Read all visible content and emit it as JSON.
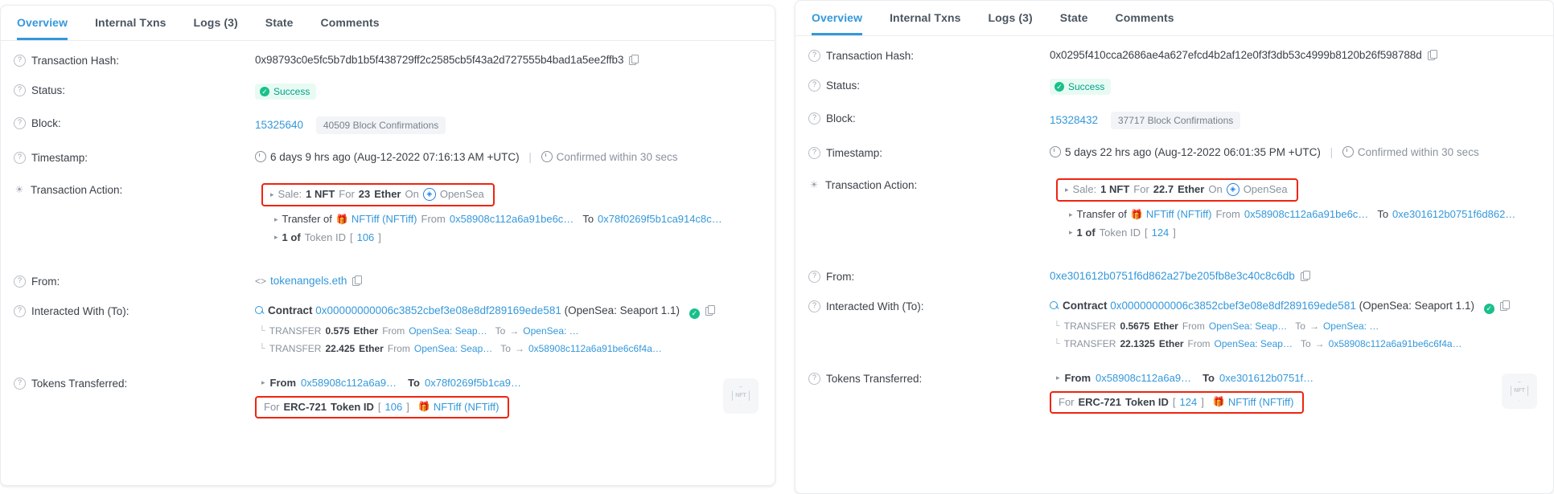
{
  "tabs": [
    "Overview",
    "Internal Txns",
    "Logs (3)",
    "State",
    "Comments"
  ],
  "labels": {
    "transaction_hash": "Transaction Hash:",
    "status": "Status:",
    "block": "Block:",
    "timestamp": "Timestamp:",
    "transaction_action": "Transaction Action:",
    "from": "From:",
    "interacted_with": "Interacted With (To):",
    "tokens_transferred": "Tokens Transferred:"
  },
  "common": {
    "status_text": "Success",
    "block_confirmations_suffix": "Block Confirmations",
    "confirmed_within": "Confirmed within 30 secs",
    "sale_prefix": "Sale:",
    "sale_nft": "1 NFT",
    "sale_for": "For",
    "sale_ether_unit": "Ether",
    "sale_on": "On",
    "marketplace": "OpenSea",
    "transfer_of": "Transfer of",
    "token_name": "NFTiff (NFTiff)",
    "from_word": "From",
    "to_word": "To",
    "one_of": "1 of",
    "token_id_word": "Token ID",
    "contract_word": "Contract",
    "contract_address": "0x00000000006c3852cbef3e08e8df289169ede581",
    "contract_label": "(OpenSea: Seaport 1.1)",
    "transfer_word": "TRANSFER",
    "ether_word": "Ether",
    "opensea_seaport_short": "OpenSea: Seap…",
    "opensea_short": "OpenSea: …",
    "for_word": "For",
    "erc721_word": "ERC-721",
    "token_id_label": "Token ID",
    "nft_thumb_label": "NFT"
  },
  "colors": {
    "accent_blue": "#3498db",
    "success_green": "#19c08a",
    "highlight_red": "#f0240f",
    "muted_grey": "#8a939d",
    "text_dark": "#3b4149"
  },
  "left_panel": {
    "transaction_hash": "0x98793c0e5fc5b7db1b5f438729ff2c2585cb5f43a2d727555b4bad1a5ee2ffb3",
    "block_number": "15325640",
    "block_confirmations": "40509",
    "timestamp_relative": "6 days 9 hrs ago",
    "timestamp_absolute": "(Aug-12-2022 07:16:13 AM +UTC)",
    "sale_amount": "23",
    "transfer_from": "0x58908c112a6a91be6c…",
    "transfer_to": "0x78f0269f5b1ca914c8c…",
    "token_id": "106",
    "from_address": "tokenangels.eth",
    "transfer_1_amount": "0.575",
    "transfer_1_to": "OpenSea: …",
    "transfer_2_amount": "22.425",
    "transfer_2_to": "0x58908c112a6a91be6c6f4a…",
    "tokens_from": "0x58908c112a6a9…",
    "tokens_to": "0x78f0269f5b1ca9…",
    "tokens_token_id": "106",
    "tokens_token_name": "NFTiff (NFTiff)"
  },
  "right_panel": {
    "transaction_hash": "0x0295f410cca2686ae4a627efcd4b2af12e0f3f3db53c4999b8120b26f598788d",
    "block_number": "15328432",
    "block_confirmations": "37717",
    "timestamp_relative": "5 days 22 hrs ago",
    "timestamp_absolute": "(Aug-12-2022 06:01:35 PM +UTC)",
    "sale_amount": "22.7",
    "transfer_from": "0x58908c112a6a91be6c…",
    "transfer_to": "0xe301612b0751f6d862…",
    "token_id": "124",
    "from_address": "0xe301612b0751f6d862a27be205fb8e3c40c8c6db",
    "transfer_1_amount": "0.5675",
    "transfer_1_to": "OpenSea: …",
    "transfer_2_amount": "22.1325",
    "transfer_2_to": "0x58908c112a6a91be6c6f4a…",
    "tokens_from": "0x58908c112a6a9…",
    "tokens_to": "0xe301612b0751f…",
    "tokens_token_id": "124",
    "tokens_token_name": "NFTiff (NFTiff)"
  }
}
